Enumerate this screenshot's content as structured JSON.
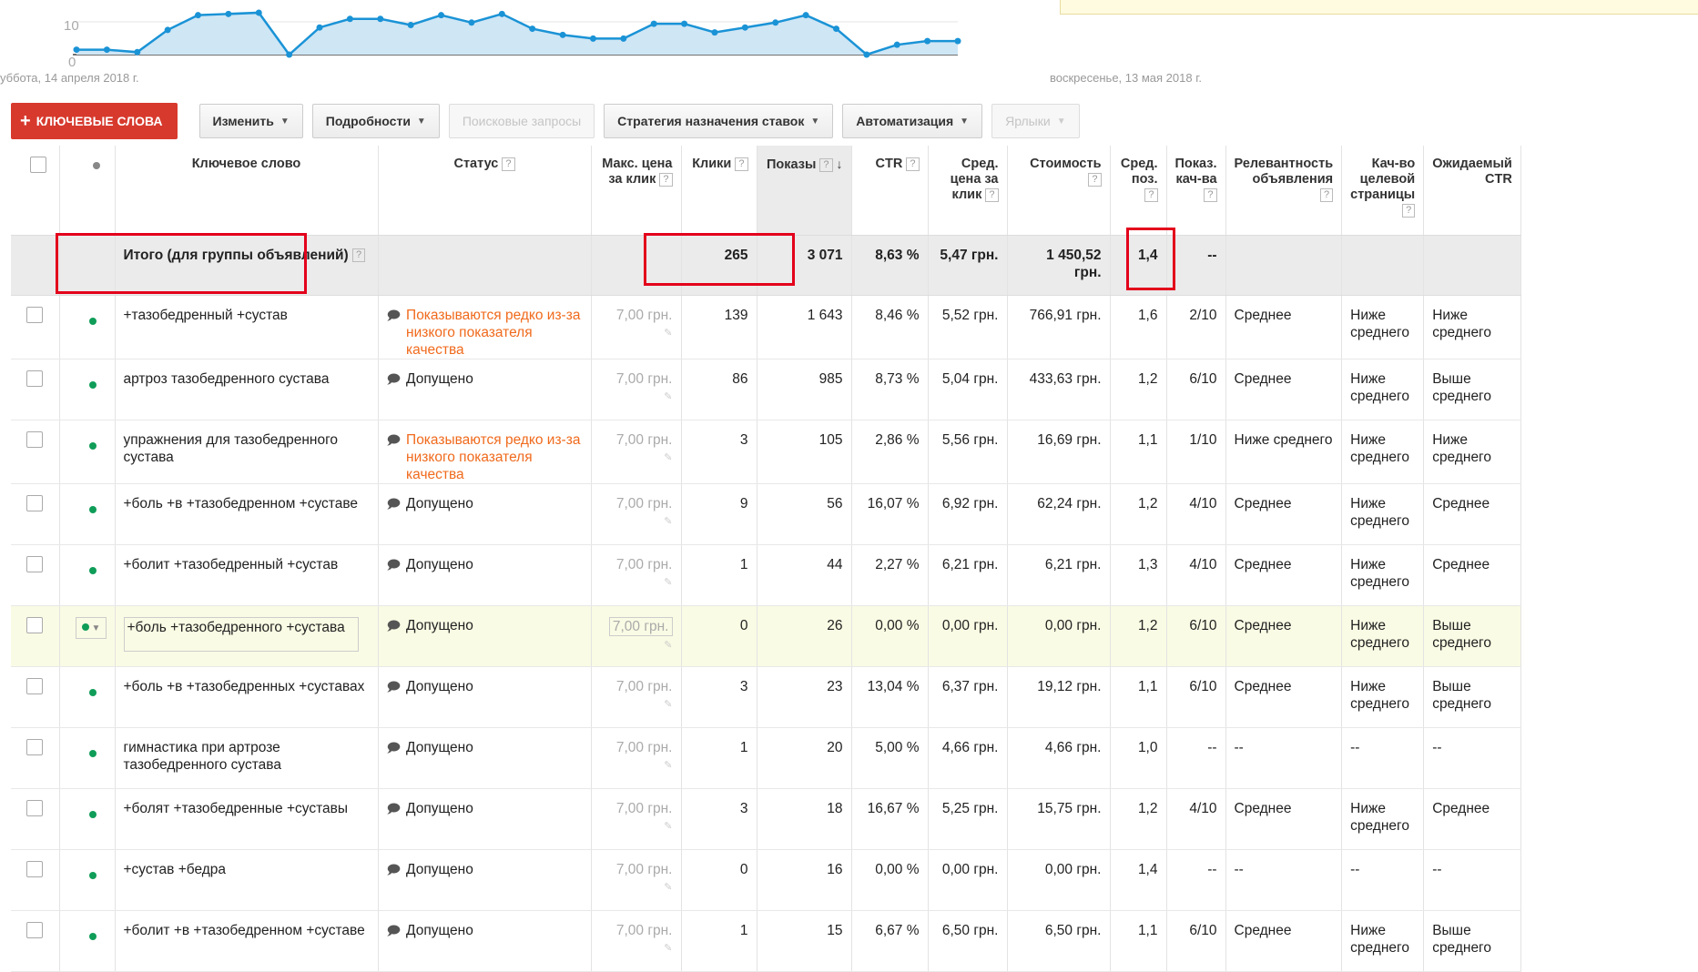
{
  "chart": {
    "y_labels": [
      "10",
      "0"
    ],
    "start_date": "уббота, 14 апреля 2018 г.",
    "end_date": "воскресенье, 13 мая 2018 г.",
    "line_color": "#1a93d6",
    "fill_color": "#cfe6f5"
  },
  "chart_data": {
    "type": "area",
    "ylim": [
      0,
      30
    ],
    "values": [
      2,
      2,
      1,
      10,
      16,
      16.5,
      17,
      0,
      11,
      14.5,
      14.5,
      12,
      16,
      13,
      16.5,
      10.5,
      8,
      6.5,
      6.5,
      12.5,
      12.5,
      9,
      11,
      13,
      16,
      10.5,
      0,
      4,
      5.5,
      5.5
    ]
  },
  "toolbar": {
    "add_label": "КЛЮЧЕВЫЕ СЛОВА",
    "buttons": [
      {
        "label": "Изменить",
        "caret": true,
        "disabled": false
      },
      {
        "label": "Подробности",
        "caret": true,
        "disabled": false
      },
      {
        "label": "Поисковые запросы",
        "caret": false,
        "disabled": true
      },
      {
        "label": "Стратегия назначения ставок",
        "caret": true,
        "disabled": false
      },
      {
        "label": "Автоматизация",
        "caret": true,
        "disabled": false
      },
      {
        "label": "Ярлыки",
        "caret": true,
        "disabled": true
      }
    ]
  },
  "table": {
    "headers": {
      "keyword": "Ключевое слово",
      "status": "Статус",
      "max_cpc_1": "Макс. цена",
      "max_cpc_2": "за клик",
      "clicks": "Клики",
      "impressions": "Показы",
      "ctr": "CTR",
      "avg_cpc_1": "Сред.",
      "avg_cpc_2": "цена за",
      "avg_cpc_3": "клик",
      "cost": "Стоимость",
      "avg_pos_1": "Сред.",
      "avg_pos_2": "поз.",
      "qs_1": "Показ.",
      "qs_2": "кач-ва",
      "relevance_1": "Релевантность",
      "relevance_2": "объявления",
      "landing_1": "Кач-во",
      "landing_2": "целевой",
      "landing_3": "страницы",
      "expected_1": "Ожидаемый",
      "expected_2": "CTR",
      "help": "?"
    },
    "total": {
      "label": "Итого (для группы объявлений)",
      "clicks": "265",
      "impressions": "3 071",
      "ctr": "8,63 %",
      "avg_cpc": "5,47 грн.",
      "cost": "1 450,52 грн.",
      "avg_pos": "1,4",
      "qs": "--"
    },
    "rows": [
      {
        "keyword": "+тазобедренный +сустав",
        "status": "Показываются редко из-за низкого показателя качества",
        "status_type": "warn",
        "bid": "7,00 грн.",
        "clicks": "139",
        "impressions": "1 643",
        "ctr": "8,46 %",
        "avg_cpc": "5,52 грн.",
        "cost": "766,91 грн.",
        "avg_pos": "1,6",
        "qs": "2/10",
        "relevance": "Среднее",
        "landing": "Ниже среднего",
        "expected": "Ниже среднего"
      },
      {
        "keyword": "артроз тазобедренного сустава",
        "status": "Допущено",
        "status_type": "ok",
        "bid": "7,00 грн.",
        "clicks": "86",
        "impressions": "985",
        "ctr": "8,73 %",
        "avg_cpc": "5,04 грн.",
        "cost": "433,63 грн.",
        "avg_pos": "1,2",
        "qs": "6/10",
        "relevance": "Среднее",
        "landing": "Ниже среднего",
        "expected": "Выше среднего"
      },
      {
        "keyword": "упражнения для тазобедренного сустава",
        "status": "Показываются редко из-за низкого показателя качества",
        "status_type": "warn",
        "bid": "7,00 грн.",
        "clicks": "3",
        "impressions": "105",
        "ctr": "2,86 %",
        "avg_cpc": "5,56 грн.",
        "cost": "16,69 грн.",
        "avg_pos": "1,1",
        "qs": "1/10",
        "relevance": "Ниже среднего",
        "landing": "Ниже среднего",
        "expected": "Ниже среднего"
      },
      {
        "keyword": "+боль +в +тазобедренном +суставе",
        "status": "Допущено",
        "status_type": "ok",
        "bid": "7,00 грн.",
        "clicks": "9",
        "impressions": "56",
        "ctr": "16,07 %",
        "avg_cpc": "6,92 грн.",
        "cost": "62,24 грн.",
        "avg_pos": "1,2",
        "qs": "4/10",
        "relevance": "Среднее",
        "landing": "Ниже среднего",
        "expected": "Среднее"
      },
      {
        "keyword": "+болит +тазобедренный +сустав",
        "status": "Допущено",
        "status_type": "ok",
        "bid": "7,00 грн.",
        "clicks": "1",
        "impressions": "44",
        "ctr": "2,27 %",
        "avg_cpc": "6,21 грн.",
        "cost": "6,21 грн.",
        "avg_pos": "1,3",
        "qs": "4/10",
        "relevance": "Среднее",
        "landing": "Ниже среднего",
        "expected": "Среднее"
      },
      {
        "keyword": "+боль +тазобедренного +сустава",
        "status": "Допущено",
        "status_type": "ok",
        "bid": "7,00 грн.",
        "clicks": "0",
        "impressions": "26",
        "ctr": "0,00 %",
        "avg_cpc": "0,00 грн.",
        "cost": "0,00 грн.",
        "avg_pos": "1,2",
        "qs": "6/10",
        "relevance": "Среднее",
        "landing": "Ниже среднего",
        "expected": "Выше среднего",
        "hover": true
      },
      {
        "keyword": "+боль +в +тазобедренных +суставах",
        "status": "Допущено",
        "status_type": "ok",
        "bid": "7,00 грн.",
        "clicks": "3",
        "impressions": "23",
        "ctr": "13,04 %",
        "avg_cpc": "6,37 грн.",
        "cost": "19,12 грн.",
        "avg_pos": "1,1",
        "qs": "6/10",
        "relevance": "Среднее",
        "landing": "Ниже среднего",
        "expected": "Выше среднего"
      },
      {
        "keyword": "гимнастика при артрозе тазобедренного сустава",
        "status": "Допущено",
        "status_type": "ok",
        "bid": "7,00 грн.",
        "clicks": "1",
        "impressions": "20",
        "ctr": "5,00 %",
        "avg_cpc": "4,66 грн.",
        "cost": "4,66 грн.",
        "avg_pos": "1,0",
        "qs": "--",
        "relevance": "--",
        "landing": "--",
        "expected": "--"
      },
      {
        "keyword": "+болят +тазобедренные +суставы",
        "status": "Допущено",
        "status_type": "ok",
        "bid": "7,00 грн.",
        "clicks": "3",
        "impressions": "18",
        "ctr": "16,67 %",
        "avg_cpc": "5,25 грн.",
        "cost": "15,75 грн.",
        "avg_pos": "1,2",
        "qs": "4/10",
        "relevance": "Среднее",
        "landing": "Ниже среднего",
        "expected": "Среднее"
      },
      {
        "keyword": "+сустав +бедра",
        "status": "Допущено",
        "status_type": "ok",
        "bid": "7,00 грн.",
        "clicks": "0",
        "impressions": "16",
        "ctr": "0,00 %",
        "avg_cpc": "0,00 грн.",
        "cost": "0,00 грн.",
        "avg_pos": "1,4",
        "qs": "--",
        "relevance": "--",
        "landing": "--",
        "expected": "--"
      },
      {
        "keyword": "+болит +в +тазобедренном +суставе",
        "status": "Допущено",
        "status_type": "ok",
        "bid": "7,00 грн.",
        "clicks": "1",
        "impressions": "15",
        "ctr": "6,67 %",
        "avg_cpc": "6,50 грн.",
        "cost": "6,50 грн.",
        "avg_pos": "1,1",
        "qs": "6/10",
        "relevance": "Среднее",
        "landing": "Ниже среднего",
        "expected": "Выше среднего"
      }
    ]
  }
}
